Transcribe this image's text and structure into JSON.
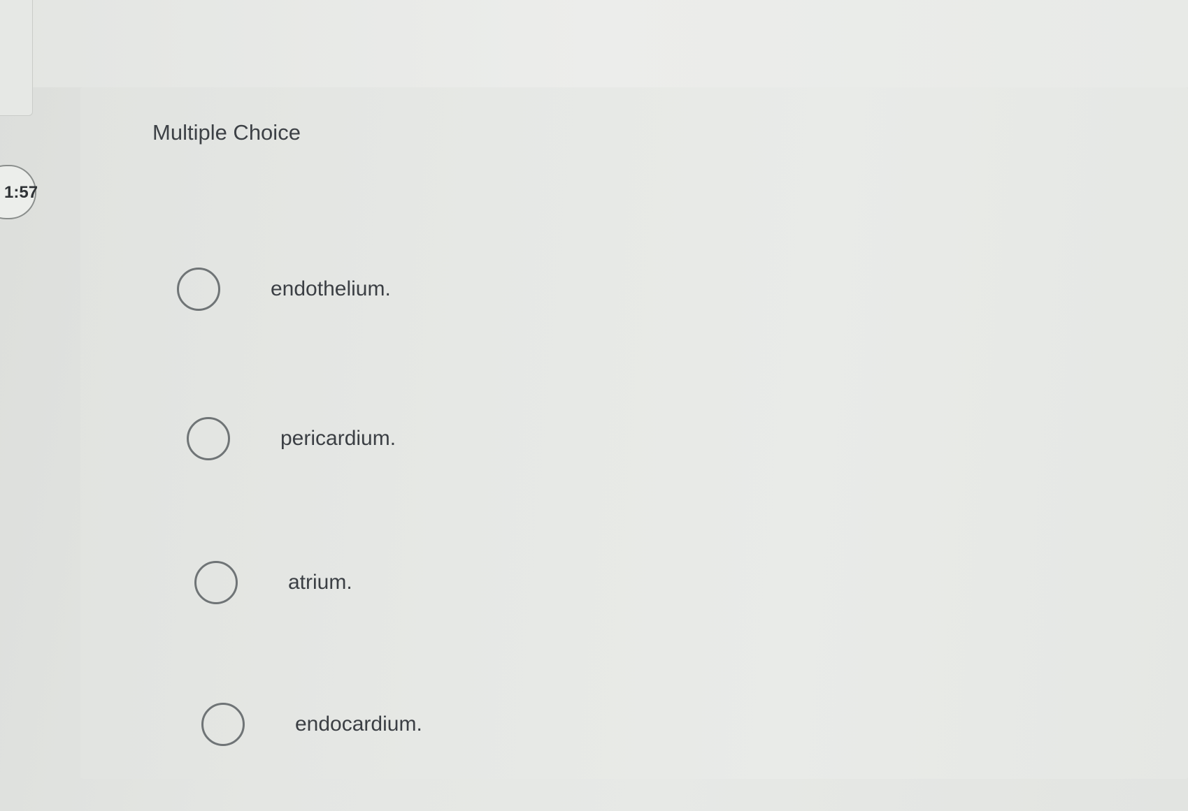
{
  "timer": {
    "text": "1:57"
  },
  "question": {
    "type_label": "Multiple Choice"
  },
  "options": [
    {
      "label": "endothelium."
    },
    {
      "label": "pericardium."
    },
    {
      "label": "atrium."
    },
    {
      "label": "endocardium."
    }
  ]
}
